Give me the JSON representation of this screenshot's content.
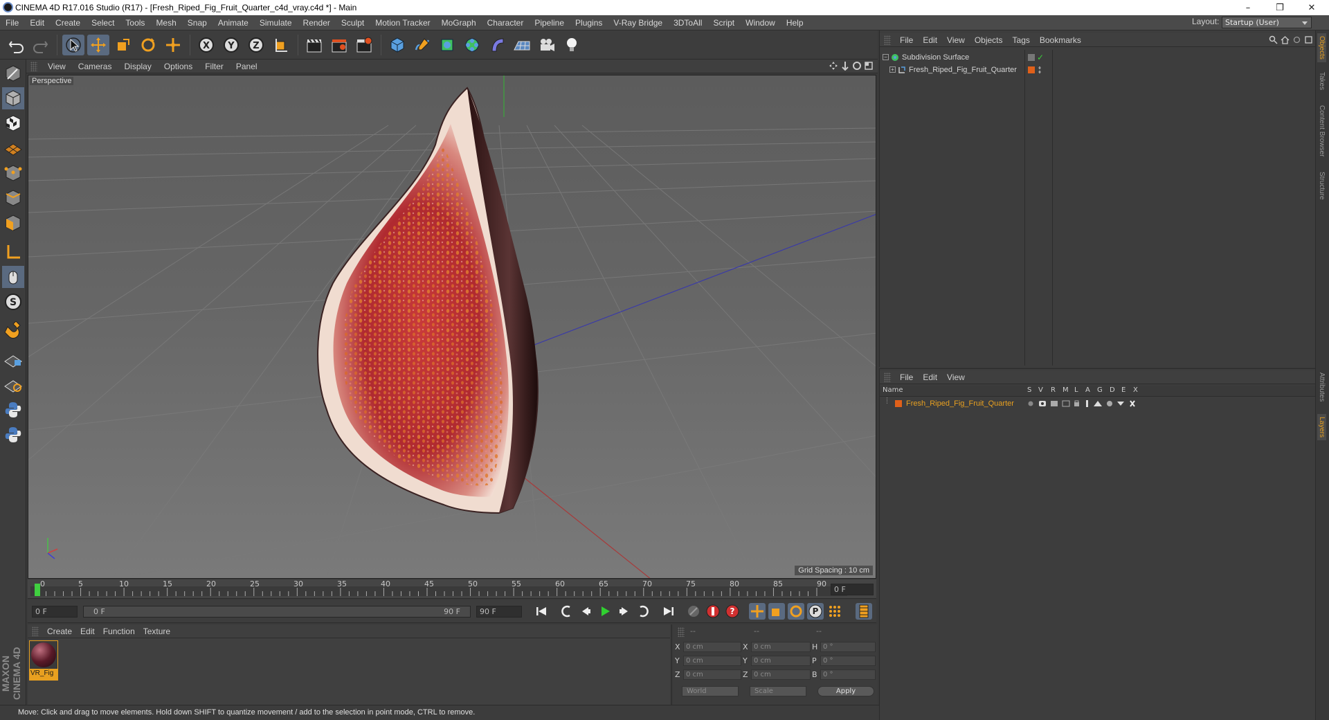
{
  "window": {
    "title": "CINEMA 4D R17.016 Studio (R17) - [Fresh_Riped_Fig_Fruit_Quarter_c4d_vray.c4d *] - Main",
    "minimize": "–",
    "restore": "❒",
    "close": "✕"
  },
  "menu": [
    "File",
    "Edit",
    "Create",
    "Select",
    "Tools",
    "Mesh",
    "Snap",
    "Animate",
    "Simulate",
    "Render",
    "Sculpt",
    "Motion Tracker",
    "MoGraph",
    "Character",
    "Pipeline",
    "Plugins",
    "V-Ray Bridge",
    "3DToAll",
    "Script",
    "Window",
    "Help"
  ],
  "layout": {
    "label": "Layout:",
    "value": "Startup (User)"
  },
  "viewport": {
    "menu": [
      "View",
      "Cameras",
      "Display",
      "Options",
      "Filter",
      "Panel"
    ],
    "label": "Perspective",
    "grid_spacing": "Grid Spacing : 10 cm"
  },
  "timeline": {
    "ticks": [
      "0",
      "5",
      "10",
      "15",
      "20",
      "25",
      "30",
      "35",
      "40",
      "45",
      "50",
      "55",
      "60",
      "65",
      "70",
      "75",
      "80",
      "85",
      "90"
    ],
    "current_frame": "0 F",
    "start_field": "0 F",
    "range_start": "0 F",
    "range_end": "90 F",
    "end_field": "90 F"
  },
  "material_manager": {
    "menu": [
      "Create",
      "Edit",
      "Function",
      "Texture"
    ],
    "materials": [
      {
        "name": "VR_Fig"
      }
    ]
  },
  "coordinates": {
    "headers": [
      "--",
      "--",
      "--"
    ],
    "rows": [
      {
        "a": "X",
        "av": "0 cm",
        "b": "X",
        "bv": "0 cm",
        "c": "H",
        "cv": "0 °"
      },
      {
        "a": "Y",
        "av": "0 cm",
        "b": "Y",
        "bv": "0 cm",
        "c": "P",
        "cv": "0 °"
      },
      {
        "a": "Z",
        "av": "0 cm",
        "b": "Z",
        "bv": "0 cm",
        "c": "B",
        "cv": "0 °"
      }
    ],
    "mode1": "World",
    "mode2": "Scale",
    "apply": "Apply"
  },
  "status": "Move: Click and drag to move elements. Hold down SHIFT to quantize movement / add to the selection in point mode, CTRL to remove.",
  "object_manager": {
    "menu": [
      "File",
      "Edit",
      "View",
      "Objects",
      "Tags",
      "Bookmarks"
    ],
    "objects": [
      {
        "name": "Subdivision Surface"
      },
      {
        "name": "Fresh_Riped_Fig_Fruit_Quarter"
      }
    ]
  },
  "layer_manager": {
    "menu": [
      "File",
      "Edit",
      "View"
    ],
    "columns": [
      "Name",
      "S",
      "V",
      "R",
      "M",
      "L",
      "A",
      "G",
      "D",
      "E",
      "X"
    ],
    "layers": [
      {
        "name": "Fresh_Riped_Fig_Fruit_Quarter",
        "color": "#e0601a"
      }
    ]
  },
  "side_tabs": [
    "Objects",
    "Takes",
    "Content Browser",
    "Structure",
    "Attributes",
    "Layers"
  ],
  "branding": {
    "logo": "MAXON CINEMA 4D"
  },
  "colors": {
    "accent": "#e8a020",
    "layer": "#e0601a",
    "selection": "#5a7fb8"
  }
}
